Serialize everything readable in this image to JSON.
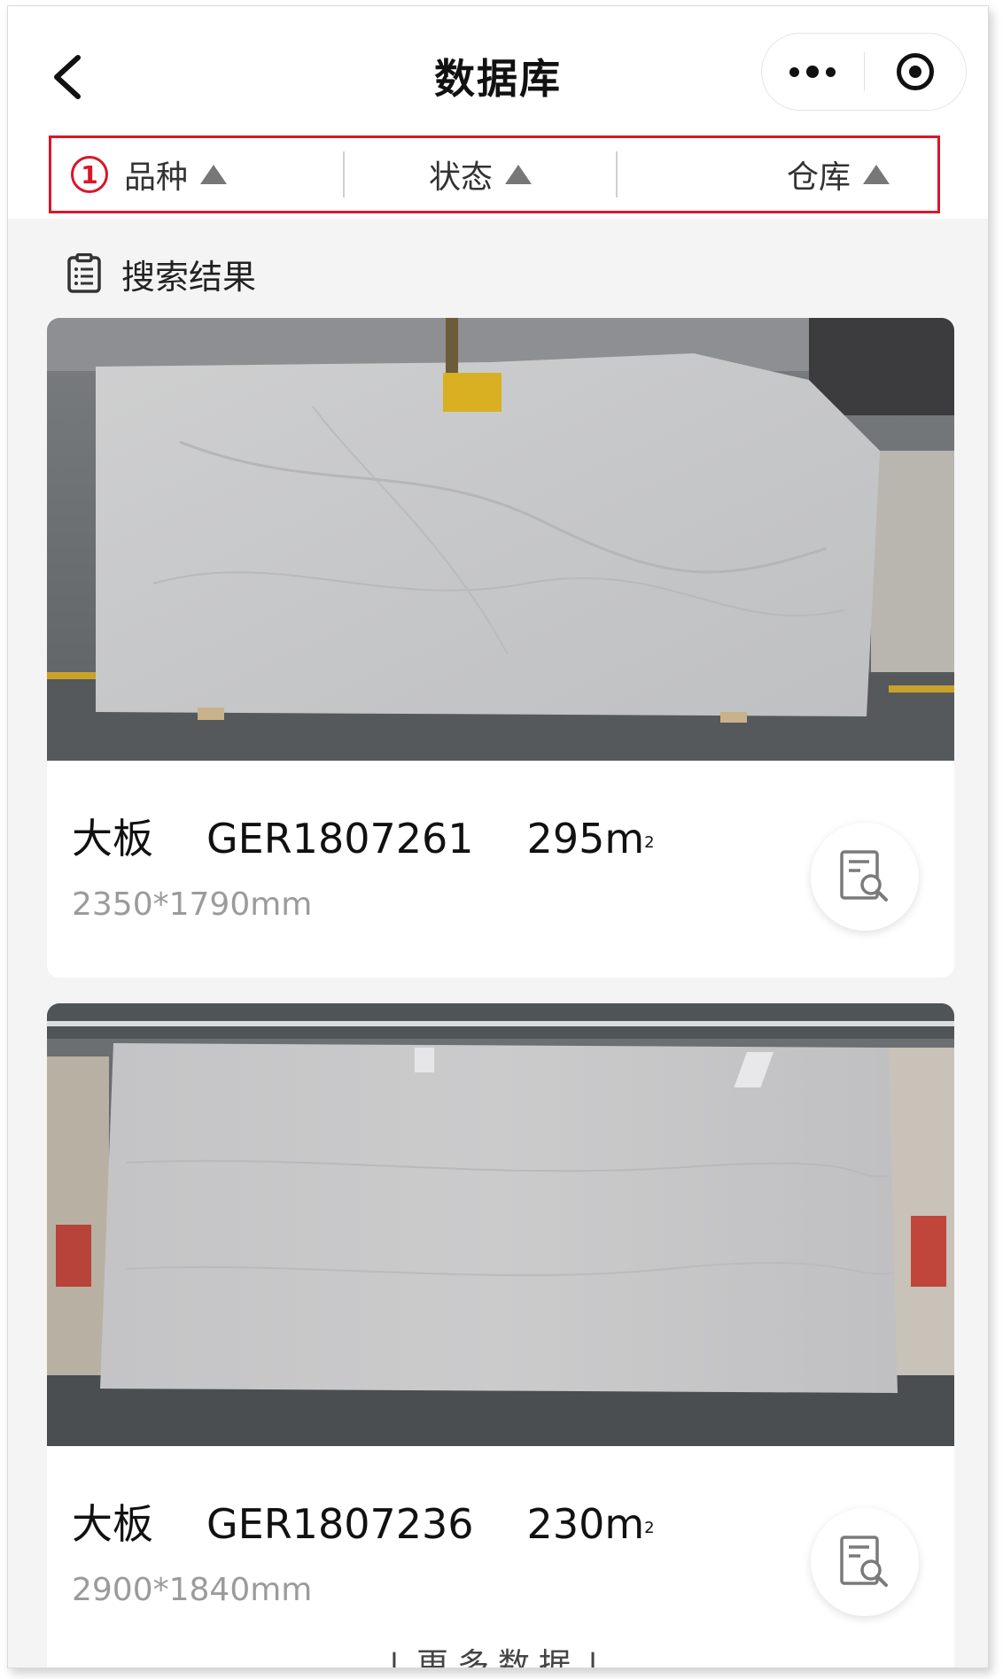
{
  "header": {
    "title": "数据库"
  },
  "filters": [
    {
      "number": "1",
      "label": "品种"
    },
    {
      "label": "状态"
    },
    {
      "label": "仓库"
    }
  ],
  "results": {
    "heading": "搜索结果"
  },
  "items": [
    {
      "type": "大板",
      "code": "GER1807261",
      "area": "295m",
      "area_sup": "2",
      "size": "2350*1790mm"
    },
    {
      "type": "大板",
      "code": "GER1807236",
      "area": "230m",
      "area_sup": "2",
      "size": "2900*1840mm"
    }
  ],
  "footer": {
    "more_label": "↓更多数据↓"
  },
  "colors": {
    "highlight": "#d8172a",
    "background": "#f4f4f4"
  }
}
